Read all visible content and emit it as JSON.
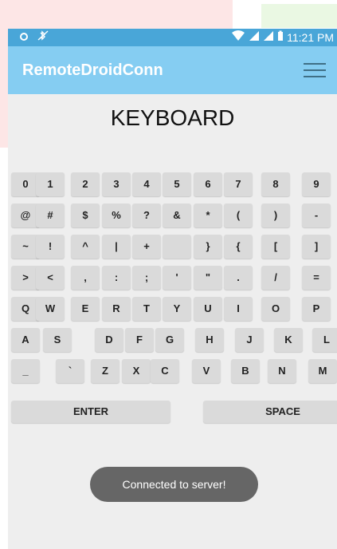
{
  "status_bar": {
    "left_icons": [
      "circle-notification-icon",
      "bluetooth-off-icon"
    ],
    "right_icons": [
      "wifi-icon",
      "signal-icon",
      "signal-icon",
      "battery-icon"
    ],
    "time": "11:21 PM"
  },
  "app_bar": {
    "title": "RemoteDroidConn",
    "menu_icon": "hamburger-menu-icon"
  },
  "keyboard": {
    "title": "KEYBOARD",
    "rows": [
      [
        "0",
        "1",
        "2",
        "3",
        "4",
        "5",
        "6",
        "7",
        "8",
        "9"
      ],
      [
        "@",
        "#",
        "$",
        "%",
        "?",
        "&",
        "*",
        "(",
        ")",
        "-"
      ],
      [
        "~",
        "!",
        "^",
        "|",
        "+",
        "",
        "}",
        "{",
        "[",
        "]"
      ],
      [
        ">",
        "<",
        ",",
        ":",
        ";",
        "'",
        "\"",
        ".",
        "/",
        "="
      ],
      [
        "Q",
        "W",
        "E",
        "R",
        "T",
        "Y",
        "U",
        "I",
        "O",
        "P"
      ],
      [
        "A",
        "S",
        "D",
        "F",
        "G",
        "H",
        "J",
        "K",
        "L"
      ],
      [
        "_",
        "`",
        "Z",
        "X",
        "C",
        "V",
        "B",
        "N",
        "M"
      ]
    ],
    "enter_label": "ENTER",
    "space_label": "SPACE"
  },
  "toast": {
    "message": "Connected to server!"
  },
  "colors": {
    "status_bar": "#49a6d8",
    "app_bar": "#85cdf2",
    "background": "#eeeeee",
    "key": "#dadada",
    "toast": "#666666"
  }
}
